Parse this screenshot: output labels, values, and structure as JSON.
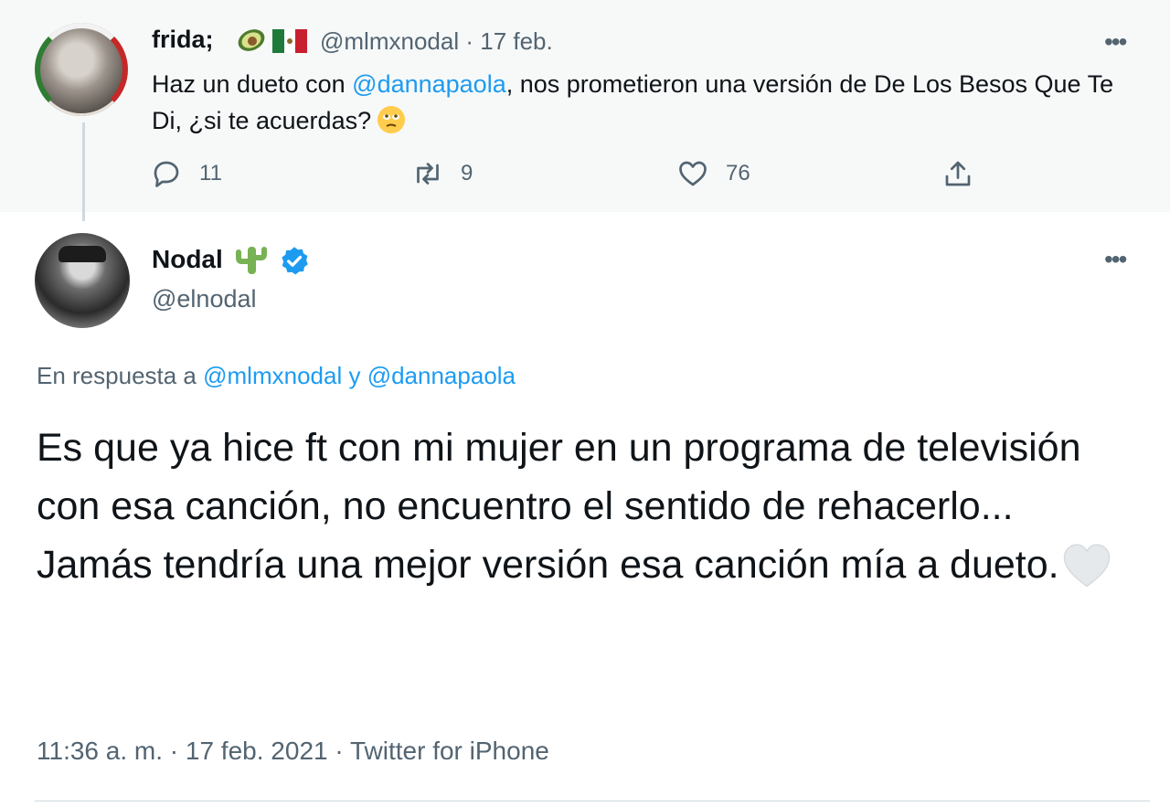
{
  "reply_tweet": {
    "display_name": "frida;",
    "handle": "@mlmxnodal",
    "date": "17 feb.",
    "more_label": "•••",
    "text_before": "Haz un dueto con ",
    "mention": "@dannapaola",
    "text_after": ", nos prometieron una versión de De Los Besos Que Te Di, ¿si te acuerdas?",
    "emojis": [
      "avocado-emoji",
      "mexico-flag-emoji",
      "face-emoji"
    ],
    "actions": {
      "reply_count": "11",
      "retweet_count": "9",
      "like_count": "76"
    }
  },
  "main_tweet": {
    "display_name": "Nodal",
    "handle": "@elnodal",
    "more_label": "•••",
    "replying_prefix": "En respuesta a",
    "replying_to_1": "@mlmxnodal",
    "replying_join": "y",
    "replying_to_2": "@dannapaola",
    "text": "Es que ya hice ft con mi mujer en un programa de televisión con esa canción, no encuentro el sentido de rehacerlo...\nJamás tendría una mejor versión esa canción mía a dueto.",
    "emojis": [
      "cactus-emoji",
      "verified-badge-icon",
      "white-heart-emoji"
    ],
    "timestamp": "11:36 a. m. · 17 feb. 2021 · Twitter for iPhone"
  },
  "colors": {
    "accent": "#1d9bf0",
    "secondary_text": "#536471",
    "reply_background": "#f7f9f9"
  }
}
